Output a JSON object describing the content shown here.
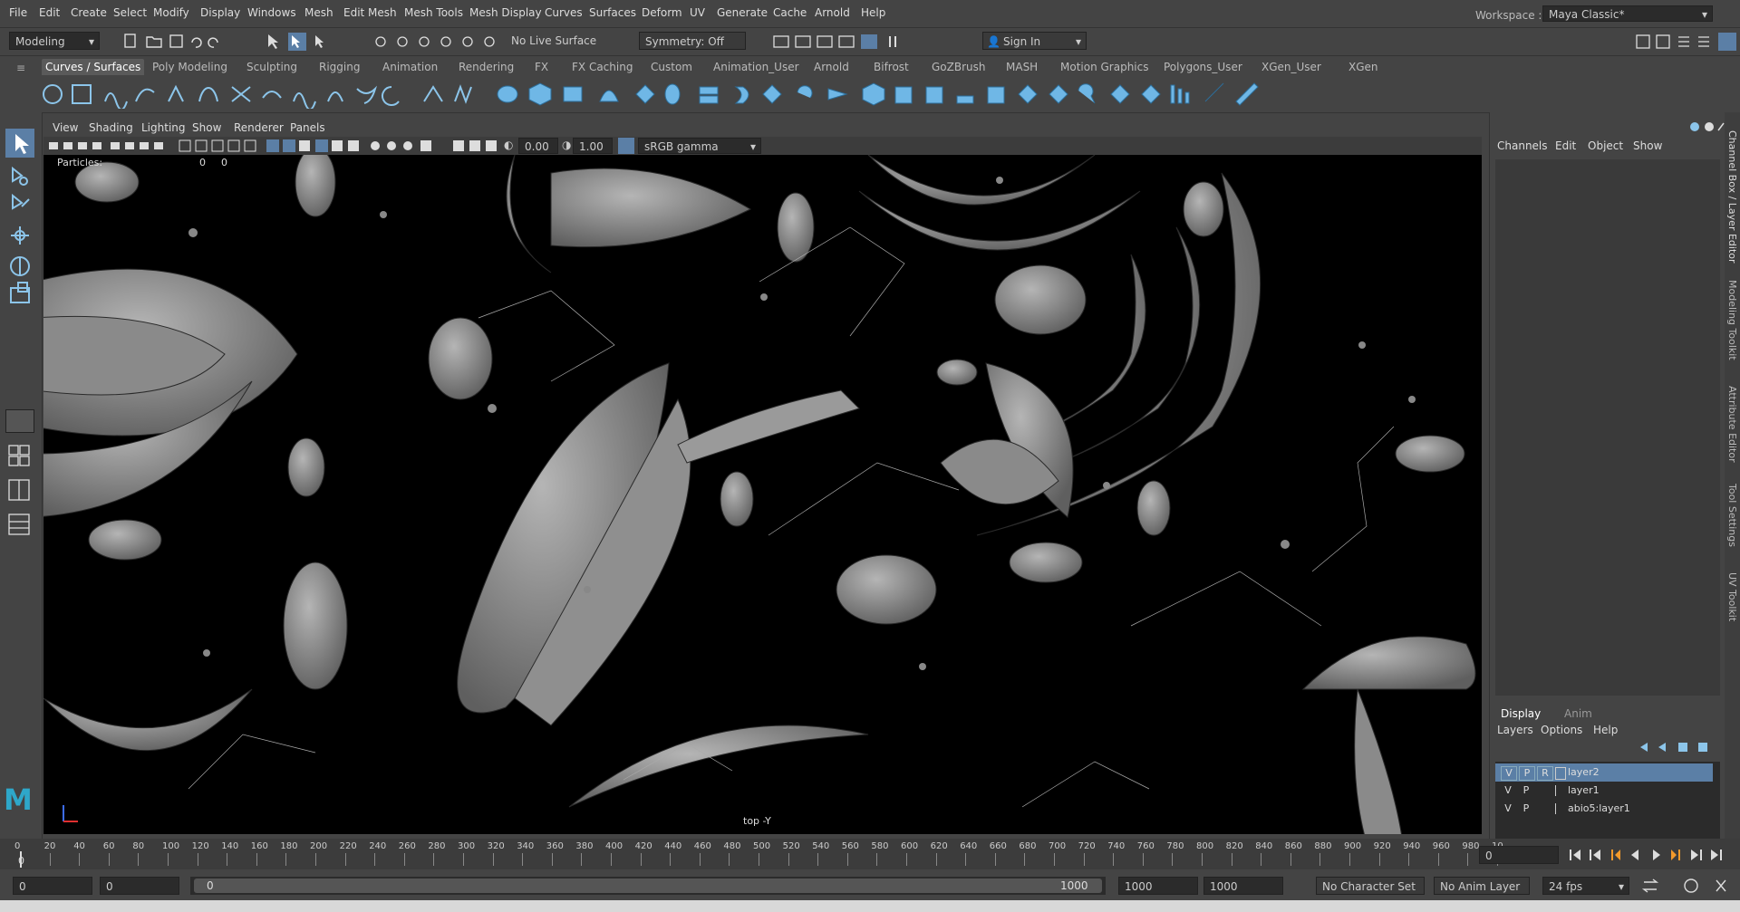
{
  "menu": [
    "File",
    "Edit",
    "Create",
    "Select",
    "Modify",
    "Display",
    "Windows",
    "Mesh",
    "Edit Mesh",
    "Mesh Tools",
    "Mesh Display",
    "Curves",
    "Surfaces",
    "Deform",
    "UV",
    "Generate",
    "Cache",
    "Arnold",
    "Help"
  ],
  "workspace": {
    "label": "Workspace :",
    "value": "Maya Classic*"
  },
  "status": {
    "mode": "Modeling",
    "live_surface": "No Live Surface",
    "symmetry": "Symmetry: Off",
    "sign_in": "Sign In"
  },
  "shelf_tabs": [
    "Curves / Surfaces",
    "Poly Modeling",
    "Sculpting",
    "Rigging",
    "Animation",
    "Rendering",
    "FX",
    "FX Caching",
    "Custom",
    "Animation_User",
    "Arnold",
    "Bifrost",
    "GoZBrush",
    "MASH",
    "Motion Graphics",
    "Polygons_User",
    "XGen_User",
    "XGen"
  ],
  "viewport": {
    "menu": [
      "View",
      "Shading",
      "Lighting",
      "Show",
      "Renderer",
      "Panels"
    ],
    "exposure": "0.00",
    "gamma": "1.00",
    "color_space": "sRGB gamma",
    "hud_particles": "Particles:",
    "hud_particles_v1": "0",
    "hud_particles_v2": "0",
    "camera": "top -Y"
  },
  "channel_box": {
    "menu": [
      "Channels",
      "Edit",
      "Object",
      "Show"
    ],
    "tabs": [
      "Display",
      "Anim"
    ],
    "layer_menu": [
      "Layers",
      "Options",
      "Help"
    ],
    "layers": [
      {
        "v": "V",
        "p": "P",
        "r": "R",
        "name": "layer2",
        "selected": true
      },
      {
        "v": "V",
        "p": "P",
        "r": "",
        "name": "layer1",
        "selected": false
      },
      {
        "v": "V",
        "p": "P",
        "r": "",
        "name": "abio5:layer1",
        "selected": false
      }
    ]
  },
  "side_tabs": [
    "Channel Box / Layer Editor",
    "Modeling Toolkit",
    "Attribute Editor",
    "Tool Settings",
    "UV Toolkit"
  ],
  "timeline": {
    "ticks": [
      "0",
      "20",
      "40",
      "60",
      "80",
      "100",
      "120",
      "140",
      "160",
      "180",
      "200",
      "220",
      "240",
      "260",
      "280",
      "300",
      "320",
      "340",
      "360",
      "380",
      "400",
      "420",
      "440",
      "460",
      "480",
      "500",
      "520",
      "540",
      "560",
      "580",
      "600",
      "620",
      "640",
      "660",
      "680",
      "700",
      "720",
      "740",
      "760",
      "780",
      "800",
      "820",
      "840",
      "860",
      "880",
      "900",
      "920",
      "940",
      "960",
      "980",
      "10"
    ],
    "current": "0",
    "current_field": "0"
  },
  "range": {
    "start": "0",
    "anim_start": "0",
    "slider_start": "0",
    "slider_end": "1000",
    "anim_end": "1000",
    "end": "1000",
    "char_set": "No Character Set",
    "anim_layer": "No Anim Layer",
    "fps": "24 fps"
  }
}
